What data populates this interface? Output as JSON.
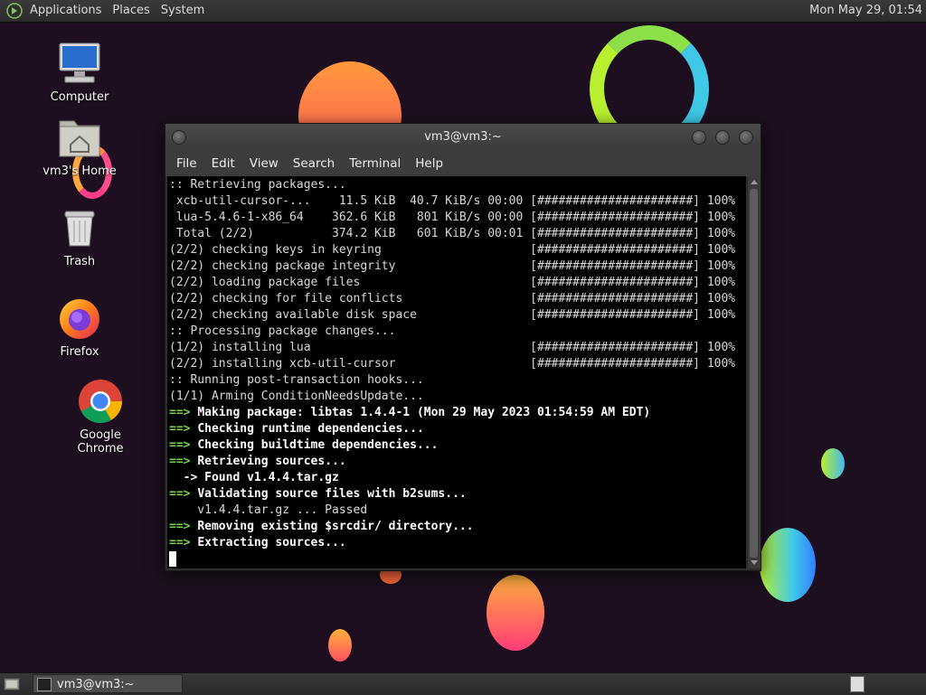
{
  "top_panel": {
    "menus": [
      "Applications",
      "Places",
      "System"
    ],
    "clock": "Mon May 29, 01:54"
  },
  "desktop_icons": [
    {
      "label": "Computer",
      "icon": "computer-icon"
    },
    {
      "label": "vm3's Home",
      "icon": "home-folder-icon"
    },
    {
      "label": "Trash",
      "icon": "trash-icon"
    },
    {
      "label": "Firefox",
      "icon": "firefox-icon"
    },
    {
      "label": "Google Chrome",
      "icon": "chrome-icon"
    }
  ],
  "terminal": {
    "title": "vm3@vm3:~",
    "menu": [
      "File",
      "Edit",
      "View",
      "Search",
      "Terminal",
      "Help"
    ],
    "lines": [
      {
        "t": ":: Retrieving packages...",
        "s": "plain"
      },
      {
        "t": " xcb-util-cursor-...    11.5 KiB  40.7 KiB/s 00:00 [######################] 100%",
        "s": "plain"
      },
      {
        "t": " lua-5.4.6-1-x86_64    362.6 KiB   801 KiB/s 00:00 [######################] 100%",
        "s": "plain"
      },
      {
        "t": " Total (2/2)           374.2 KiB   601 KiB/s 00:01 [######################] 100%",
        "s": "plain"
      },
      {
        "t": "(2/2) checking keys in keyring                     [######################] 100%",
        "s": "plain"
      },
      {
        "t": "(2/2) checking package integrity                   [######################] 100%",
        "s": "plain"
      },
      {
        "t": "(2/2) loading package files                        [######################] 100%",
        "s": "plain"
      },
      {
        "t": "(2/2) checking for file conflicts                  [######################] 100%",
        "s": "plain"
      },
      {
        "t": "(2/2) checking available disk space                [######################] 100%",
        "s": "plain"
      },
      {
        "t": ":: Processing package changes...",
        "s": "plain"
      },
      {
        "t": "(1/2) installing lua                               [######################] 100%",
        "s": "plain"
      },
      {
        "t": "(2/2) installing xcb-util-cursor                   [######################] 100%",
        "s": "plain"
      },
      {
        "t": ":: Running post-transaction hooks...",
        "s": "plain"
      },
      {
        "t": "(1/1) Arming ConditionNeedsUpdate...",
        "s": "plain"
      },
      {
        "p": "==> ",
        "t": "Making package: libtas 1.4.4-1 (Mon 29 May 2023 01:54:59 AM EDT)",
        "s": "arrow"
      },
      {
        "p": "==> ",
        "t": "Checking runtime dependencies...",
        "s": "arrow"
      },
      {
        "p": "==> ",
        "t": "Checking buildtime dependencies...",
        "s": "arrow"
      },
      {
        "p": "==> ",
        "t": "Retrieving sources...",
        "s": "arrow"
      },
      {
        "t": "  -> Found v1.4.4.tar.gz",
        "s": "bold"
      },
      {
        "p": "==> ",
        "t": "Validating source files with b2sums...",
        "s": "arrow"
      },
      {
        "t": "    v1.4.4.tar.gz ... Passed",
        "s": "plain"
      },
      {
        "p": "==> ",
        "t": "Removing existing $srcdir/ directory...",
        "s": "arrow"
      },
      {
        "p": "==> ",
        "t": "Extracting sources...",
        "s": "arrow"
      }
    ]
  },
  "taskbar": {
    "window_button": "vm3@vm3:~"
  },
  "colors": {
    "desktop_bg": "#1d0f1f",
    "prompt_arrow": "#7cd34a"
  }
}
